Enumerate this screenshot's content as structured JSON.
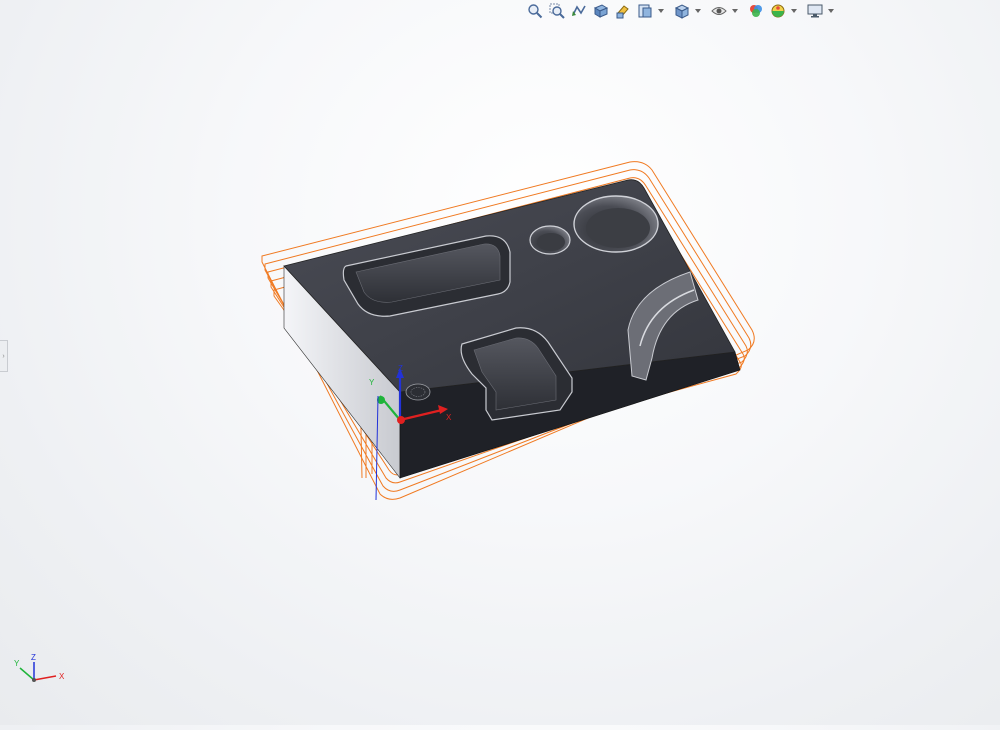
{
  "toolbar": {
    "items": [
      {
        "name": "zoom-to-fit-icon"
      },
      {
        "name": "zoom-to-area-icon"
      },
      {
        "name": "previous-view-icon"
      },
      {
        "name": "section-view-icon"
      },
      {
        "name": "dynamic-annotation-views-icon"
      },
      {
        "name": "view-orientation-icon",
        "dropdown": true
      },
      {
        "name": "display-style-icon",
        "dropdown": true
      },
      {
        "name": "hide-show-items-icon",
        "dropdown": true
      },
      {
        "name": "edit-appearance-icon"
      },
      {
        "name": "apply-scene-icon",
        "dropdown": true
      },
      {
        "name": "view-settings-icon",
        "dropdown": true
      }
    ]
  },
  "origin_triad": {
    "z": "Z",
    "y": "Y",
    "x": "X"
  },
  "view_triad": {
    "z": "Z",
    "y": "Y",
    "x": "X"
  },
  "colors": {
    "part_top": "#3d3f47",
    "part_side": "#1f2127",
    "toolpath": "#f07a22",
    "axis_x": "#e02020",
    "axis_y": "#1fb43a",
    "axis_z": "#2232d8"
  }
}
